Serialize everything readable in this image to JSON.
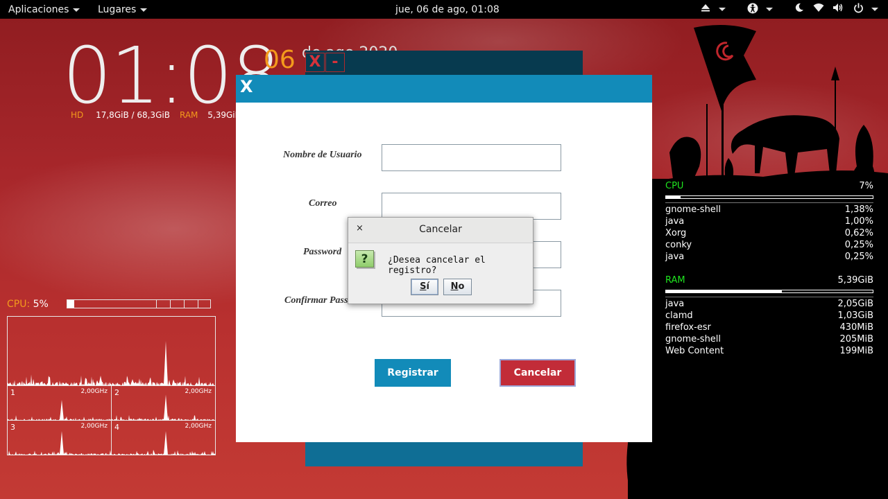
{
  "topbar": {
    "applications_label": "Aplicaciones",
    "places_label": "Lugares",
    "datetime": "jue, 06 de ago, 01:08"
  },
  "clock_widget": {
    "time": "01:08",
    "day": "06",
    "date_rest": "de ago 2020",
    "hd_label": "HD",
    "hd_value": "17,8GiB / 68,3GiB",
    "ram_label": "RAM",
    "ram_value": "5,39GiB"
  },
  "cpu_widget": {
    "label": "CPU:",
    "value": "5%",
    "usage_fraction": 0.05,
    "cores": [
      {
        "num": "1",
        "freq": "2,00GHz"
      },
      {
        "num": "2",
        "freq": "2,00GHz"
      },
      {
        "num": "3",
        "freq": "2,00GHz"
      },
      {
        "num": "4",
        "freq": "2,00GHz"
      }
    ]
  },
  "sysmon": {
    "cpu_label": "CPU",
    "cpu_value": "7%",
    "cpu_fraction": 0.07,
    "cpu_processes": [
      {
        "name": "gnome-shell",
        "value": "1,38%"
      },
      {
        "name": "java",
        "value": "1,00%"
      },
      {
        "name": "Xorg",
        "value": "0,62%"
      },
      {
        "name": "conky",
        "value": "0,25%"
      },
      {
        "name": "java",
        "value": "0,25%"
      }
    ],
    "ram_label": "RAM",
    "ram_value": "5,39GiB",
    "ram_fraction": 0.56,
    "ram_processes": [
      {
        "name": "java",
        "value": "2,05GiB"
      },
      {
        "name": "clamd",
        "value": "1,03GiB"
      },
      {
        "name": "firefox-esr",
        "value": "430MiB"
      },
      {
        "name": "gnome-shell",
        "value": "205MiB"
      },
      {
        "name": "Web Content",
        "value": "199MiB"
      }
    ]
  },
  "back_window": {
    "close_label": "X",
    "minimize_label": "-"
  },
  "form_window": {
    "close_label": "X",
    "fields": [
      {
        "label": "Nombre de Usuario",
        "value": ""
      },
      {
        "label": "Correo",
        "value": ""
      },
      {
        "label": "Password",
        "value": ""
      },
      {
        "label": "Confirmar Password",
        "value": ""
      }
    ],
    "register_button": "Registrar",
    "cancel_button": "Cancelar"
  },
  "dialog": {
    "title": "Cancelar",
    "close_label": "×",
    "icon_label": "?",
    "message": "¿Desea cancelar el registro?",
    "yes_underlined": "S",
    "yes_rest": "í",
    "no_underlined": "N",
    "no_rest": "o"
  },
  "colors": {
    "accent_blue": "#128bb9",
    "cancel_red": "#c22c38",
    "conky_orange": "#f39a1c",
    "conky_green": "#1fe51f"
  }
}
